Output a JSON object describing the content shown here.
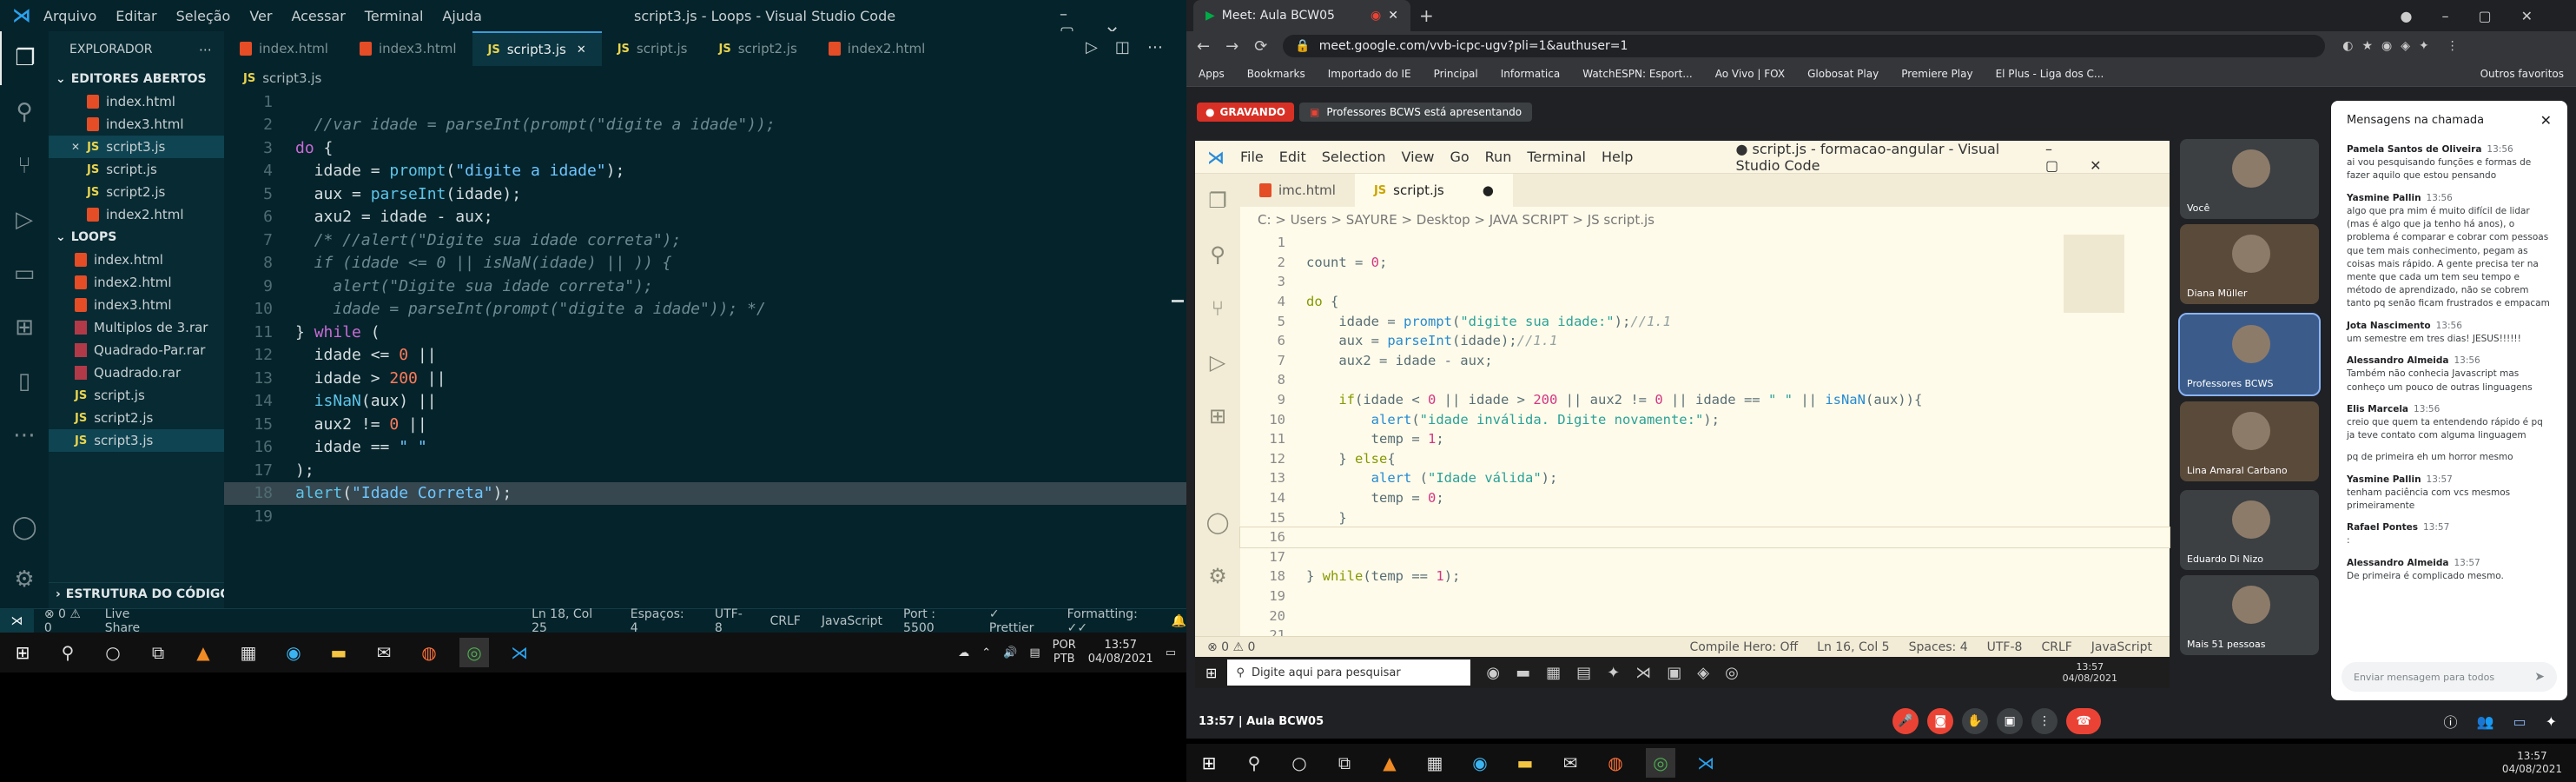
{
  "left_vscode": {
    "menu": [
      "Arquivo",
      "Editar",
      "Seleção",
      "Ver",
      "Acessar",
      "Terminal",
      "Ajuda"
    ],
    "window_title": "script3.js - Loops - Visual Studio Code",
    "explorer_title": "EXPLORADOR",
    "open_editors_title": "EDITORES ABERTOS",
    "open_editors": [
      {
        "name": "index.html",
        "type": "html"
      },
      {
        "name": "index3.html",
        "type": "html"
      },
      {
        "name": "script3.js",
        "type": "js",
        "close": "✕"
      },
      {
        "name": "script.js",
        "type": "js"
      },
      {
        "name": "script2.js",
        "type": "js"
      },
      {
        "name": "index2.html",
        "type": "html"
      }
    ],
    "folder_title": "LOOPS",
    "folder_items": [
      {
        "name": "index.html",
        "type": "html"
      },
      {
        "name": "index2.html",
        "type": "html"
      },
      {
        "name": "index3.html",
        "type": "html"
      },
      {
        "name": "Multiplos de 3.rar",
        "type": "rar"
      },
      {
        "name": "Quadrado-Par.rar",
        "type": "rar"
      },
      {
        "name": "Quadrado.rar",
        "type": "rar"
      },
      {
        "name": "script.js",
        "type": "js"
      },
      {
        "name": "script2.js",
        "type": "js"
      },
      {
        "name": "script3.js",
        "type": "js"
      }
    ],
    "outline_title": "ESTRUTURA DO CÓDIGO",
    "tabs": [
      {
        "label": "index.html",
        "type": "html"
      },
      {
        "label": "index3.html",
        "type": "html"
      },
      {
        "label": "script3.js",
        "type": "js",
        "active": true
      },
      {
        "label": "script.js",
        "type": "js"
      },
      {
        "label": "script2.js",
        "type": "js"
      },
      {
        "label": "index2.html",
        "type": "html"
      }
    ],
    "breadcrumb": "script3.js",
    "code": [
      "",
      "  //var idade = parseInt(prompt(\"digite a idade\"));",
      "do {",
      "  idade = prompt(\"digite a idade\");",
      "  aux = parseInt(idade);",
      "  axu2 = idade - aux;",
      "  /* //alert(\"Digite sua idade correta\");",
      "  if (idade <= 0 || isNaN(idade) || )) {",
      "    alert(\"Digite sua idade correta\");",
      "    idade = parseInt(prompt(\"digite a idade\")); */",
      "} while (",
      "  idade <= 0 ||",
      "  idade > 200 ||",
      "  isNaN(aux) ||",
      "  aux2 != 0 ||",
      "  idade == \" \"",
      ");",
      "alert(\"Idade Correta\");",
      ""
    ],
    "status": {
      "errors": "⊗ 0 ⚠ 0",
      "live_share": "Live Share",
      "cursor": "Ln 18, Col 25",
      "spaces": "Espaços: 4",
      "encoding": "UTF-8",
      "eol": "CRLF",
      "lang": "JavaScript",
      "port": "Port : 5500",
      "prettier": "✓ Prettier",
      "formatting": "Formatting: ✓✓"
    }
  },
  "left_taskbar": {
    "lang": "POR",
    "layout": "PTB",
    "time": "13:57",
    "date": "04/08/2021"
  },
  "chrome": {
    "tab_title": "Meet: Aula BCW05",
    "url": "meet.google.com/vvb-icpc-ugv?pli=1&authuser=1",
    "bookmarks": [
      "Apps",
      "Bookmarks",
      "Importado do IE",
      "Principal",
      "Informatica",
      "WatchESPN: Esport...",
      "Ao Vivo | FOX",
      "Globosat Play",
      "Premiere Play",
      "El Plus - Liga dos C..."
    ],
    "bookmarks_other": "Outros favoritos"
  },
  "meet": {
    "recording": "GRAVANDO",
    "presenting": "Professores BCWS está apresentando",
    "meeting_name": "13:57 | Aula BCW05",
    "participants": [
      {
        "name": "Você"
      },
      {
        "name": "Diana Müller"
      },
      {
        "name": "Professores BCWS"
      },
      {
        "name": "Lina Amaral Carbano"
      },
      {
        "name": "Eduardo Di Nizo"
      },
      {
        "name": "Mais 51 pessoas"
      }
    ],
    "chat_title": "Mensagens na chamada",
    "chat": [
      {
        "name": "Pamela Santos de Oliveira",
        "time": "13:56",
        "text": "ai vou pesquisando funções e formas de fazer aquilo que estou pensando"
      },
      {
        "name": "Yasmine Pallin",
        "time": "13:56",
        "text": "algo que pra mim é muito difícil de lidar (mas é algo que ja tenho há anos), o problema é comparar e cobrar com pessoas que tem mais conhecimento, pegam as coisas mais rápido. A gente precisa ter na mente que cada um tem seu tempo e método de aprendizado, não se cobrem tanto pq senão ficam frustrados e empacam"
      },
      {
        "name": "Jota Nascimento",
        "time": "13:56",
        "text": "um semestre em tres dias! JESUS!!!!!!"
      },
      {
        "name": "Alessandro Almeida",
        "time": "13:56",
        "text": "Também não conhecia Javascript mas conheço um pouco de outras linguagens"
      },
      {
        "name": "Elis Marcela",
        "time": "13:56",
        "text": "creio que quem ta entendendo rápido é pq ja teve contato com alguma linguagem"
      },
      {
        "name": "",
        "time": "",
        "text": "pq de primeira eh um horror mesmo"
      },
      {
        "name": "Yasmine Pallin",
        "time": "13:57",
        "text": "tenham paciência com vcs mesmos primeiramente"
      },
      {
        "name": "Rafael Pontes",
        "time": "13:57",
        "text": ":"
      },
      {
        "name": "Alessandro Almeida",
        "time": "13:57",
        "text": "De primeira é complicado mesmo."
      }
    ],
    "chat_placeholder": "Enviar mensagem para todos"
  },
  "inner_vscode": {
    "menu": [
      "File",
      "Edit",
      "Selection",
      "View",
      "Go",
      "Run",
      "Terminal",
      "Help"
    ],
    "title": "● script.js - formacao-angular - Visual Studio Code",
    "tabs": [
      {
        "label": "imc.html",
        "type": "html"
      },
      {
        "label": "script.js",
        "type": "js",
        "active": true,
        "dirty": "●"
      }
    ],
    "breadcrumb": "C: > Users > SAYURE > Desktop > JAVA SCRIPT > JS script.js",
    "code": [
      "",
      "count = 0;",
      "",
      "do {",
      "    idade = prompt(\"digite sua idade:\");//1.1",
      "    aux = parseInt(idade);//1.1",
      "    aux2 = idade - aux;",
      "",
      "    if(idade < 0 || idade > 200 || aux2 != 0 || idade == \" \" || isNaN(aux)){",
      "        alert(\"idade inválida. Digite novamente:\");",
      "        temp = 1;",
      "    } else{",
      "        alert (\"Idade válida\");",
      "        temp = 0;",
      "    }",
      "",
      "",
      "} while(temp == 1);",
      "",
      "",
      ""
    ],
    "status": {
      "errors": "⊗ 0 ⚠ 0",
      "compile": "Compile Hero: Off",
      "cursor": "Ln 16, Col 5",
      "spaces": "Spaces: 4",
      "encoding": "UTF-8",
      "eol": "CRLF",
      "lang": "JavaScript"
    },
    "taskbar_search": "Digite aqui para pesquisar",
    "taskbar_time": "13:57",
    "taskbar_date": "04/08/2021"
  },
  "right_taskbar": {
    "time": "13:57",
    "date": "04/08/2021"
  },
  "colors": {
    "vscode_dark": "#05232b",
    "meet_bg": "#202124",
    "recording": "#d93025",
    "end_call": "#ea4335"
  }
}
